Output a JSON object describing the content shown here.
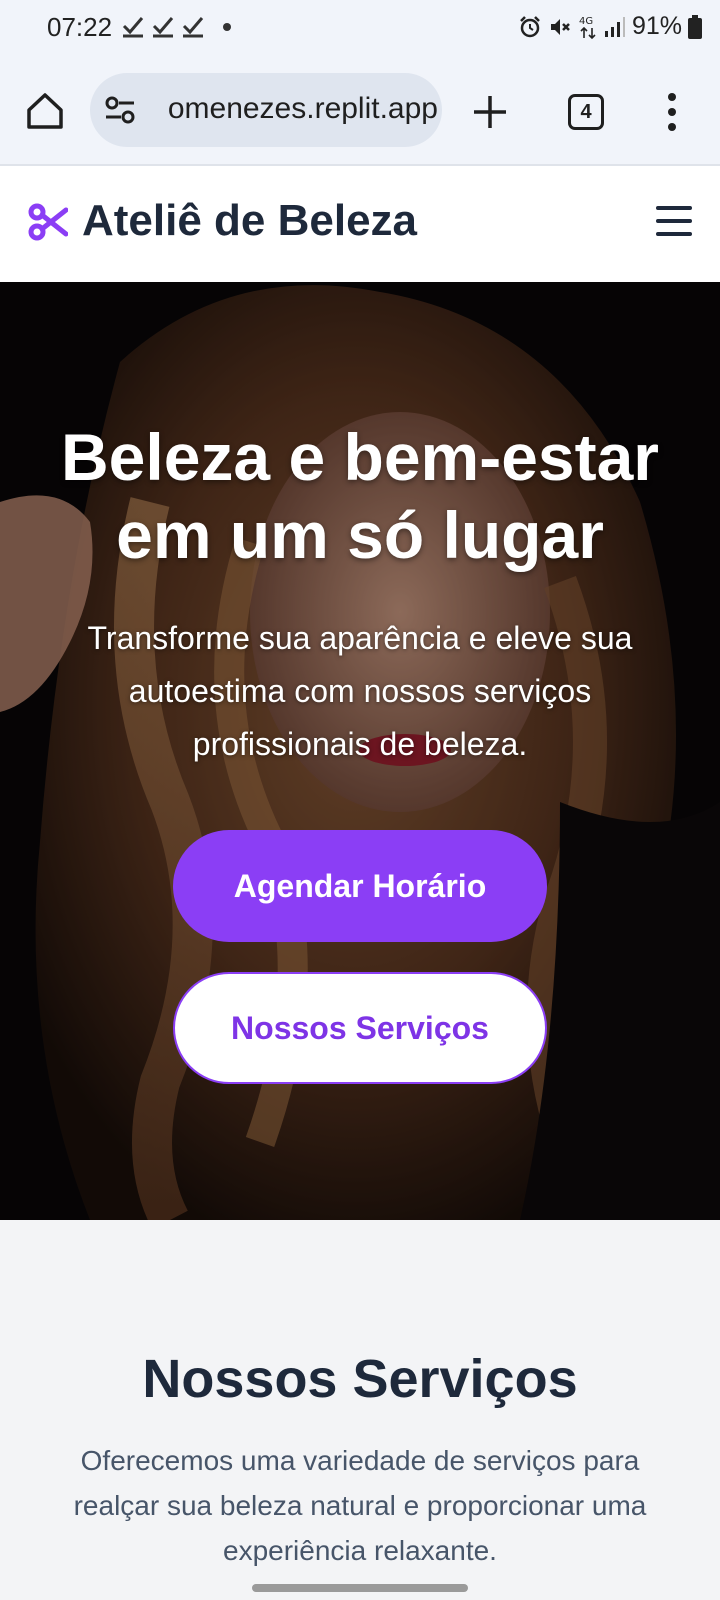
{
  "status_bar": {
    "time": "07:22",
    "battery": "91%",
    "icons": [
      "check-icon",
      "check-icon",
      "check-icon",
      "dot-icon",
      "alarm-icon",
      "mute-icon",
      "4g-icon",
      "signal-icon",
      "battery-icon"
    ]
  },
  "browser": {
    "url": "omenezes.replit.app",
    "tab_count": "4"
  },
  "site": {
    "brand": "Ateliê de Beleza",
    "colors": {
      "accent": "#8b3ef5",
      "heading": "#1e293b"
    }
  },
  "hero": {
    "title": "Beleza e bem-estar em um só lugar",
    "subtitle": "Transforme sua aparência e eleve sua autoestima com nossos serviços profissionais de beleza.",
    "primary_button": "Agendar Horário",
    "secondary_button": "Nossos Serviços"
  },
  "services": {
    "title": "Nossos Serviços",
    "description": "Oferecemos uma variedade de serviços para realçar sua beleza natural e proporcionar uma experiência relaxante."
  }
}
